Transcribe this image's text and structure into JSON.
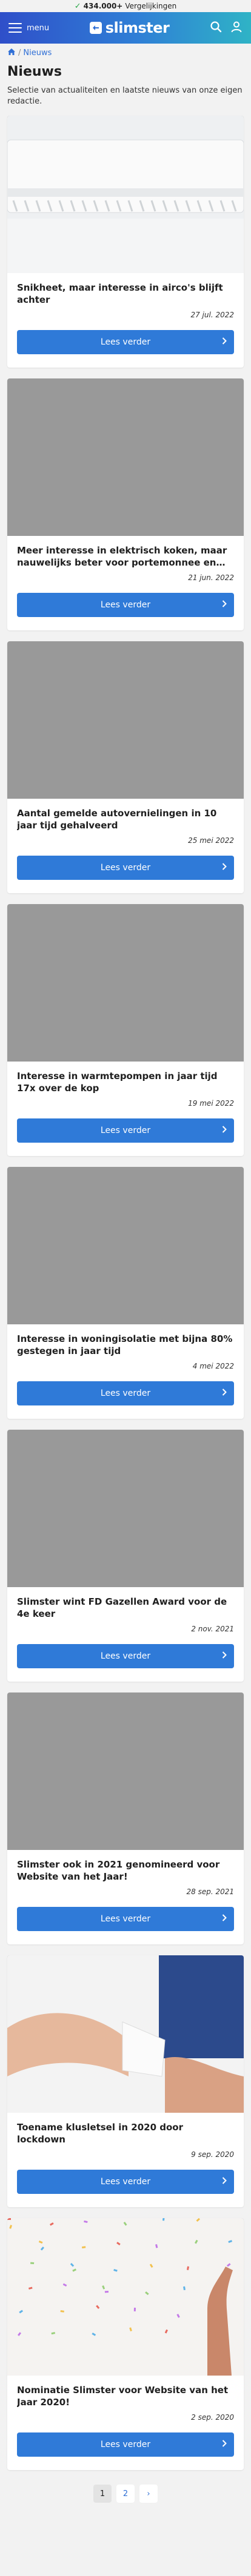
{
  "topbar": {
    "check": "✓",
    "count": "434.000+",
    "label": "Vergelijkingen"
  },
  "header": {
    "menu_label": "menu",
    "logo_text": "slimster"
  },
  "breadcrumb": {
    "separator": "/",
    "current": "Nieuws"
  },
  "page": {
    "title": "Nieuws",
    "description": "Selectie van actualiteiten en laatste nieuws van onze eigen redactie."
  },
  "articles": [
    {
      "title": "Snikheet, maar interesse in airco's blijft achter",
      "date": "27 jul. 2022",
      "button": "Lees verder",
      "image": "airco"
    },
    {
      "title": "Meer interesse in elektrisch koken, maar nauwelijks beter voor portemonnee en…",
      "date": "21 jun. 2022",
      "button": "Lees verder",
      "image": "placeholder"
    },
    {
      "title": "Aantal gemelde autovernielingen in 10 jaar tijd gehalveerd",
      "date": "25 mei 2022",
      "button": "Lees verder",
      "image": "placeholder"
    },
    {
      "title": "Interesse in warmtepompen in jaar tijd 17x over de kop",
      "date": "19 mei 2022",
      "button": "Lees verder",
      "image": "placeholder"
    },
    {
      "title": "Interesse in woningisolatie met bijna 80% gestegen in jaar tijd",
      "date": "4 mei 2022",
      "button": "Lees verder",
      "image": "placeholder"
    },
    {
      "title": "Slimster wint FD Gazellen Award voor de 4e keer",
      "date": "2 nov. 2021",
      "button": "Lees verder",
      "image": "placeholder"
    },
    {
      "title": "Slimster ook in 2021 genomineerd voor Website van het Jaar!",
      "date": "28 sep. 2021",
      "button": "Lees verder",
      "image": "placeholder"
    },
    {
      "title": "Toename klusletsel in 2020 door lockdown",
      "date": "9 sep. 2020",
      "button": "Lees verder",
      "image": "bandage"
    },
    {
      "title": "Nominatie Slimster voor Website van het Jaar 2020!",
      "date": "2 sep. 2020",
      "button": "Lees verder",
      "image": "confetti"
    }
  ],
  "pagination": {
    "pages": [
      "1",
      "2"
    ],
    "next": "›"
  },
  "colors": {
    "brand_blue": "#2f7ad8",
    "link_blue": "#2f6fd6",
    "placeholder_gray": "#999999"
  }
}
